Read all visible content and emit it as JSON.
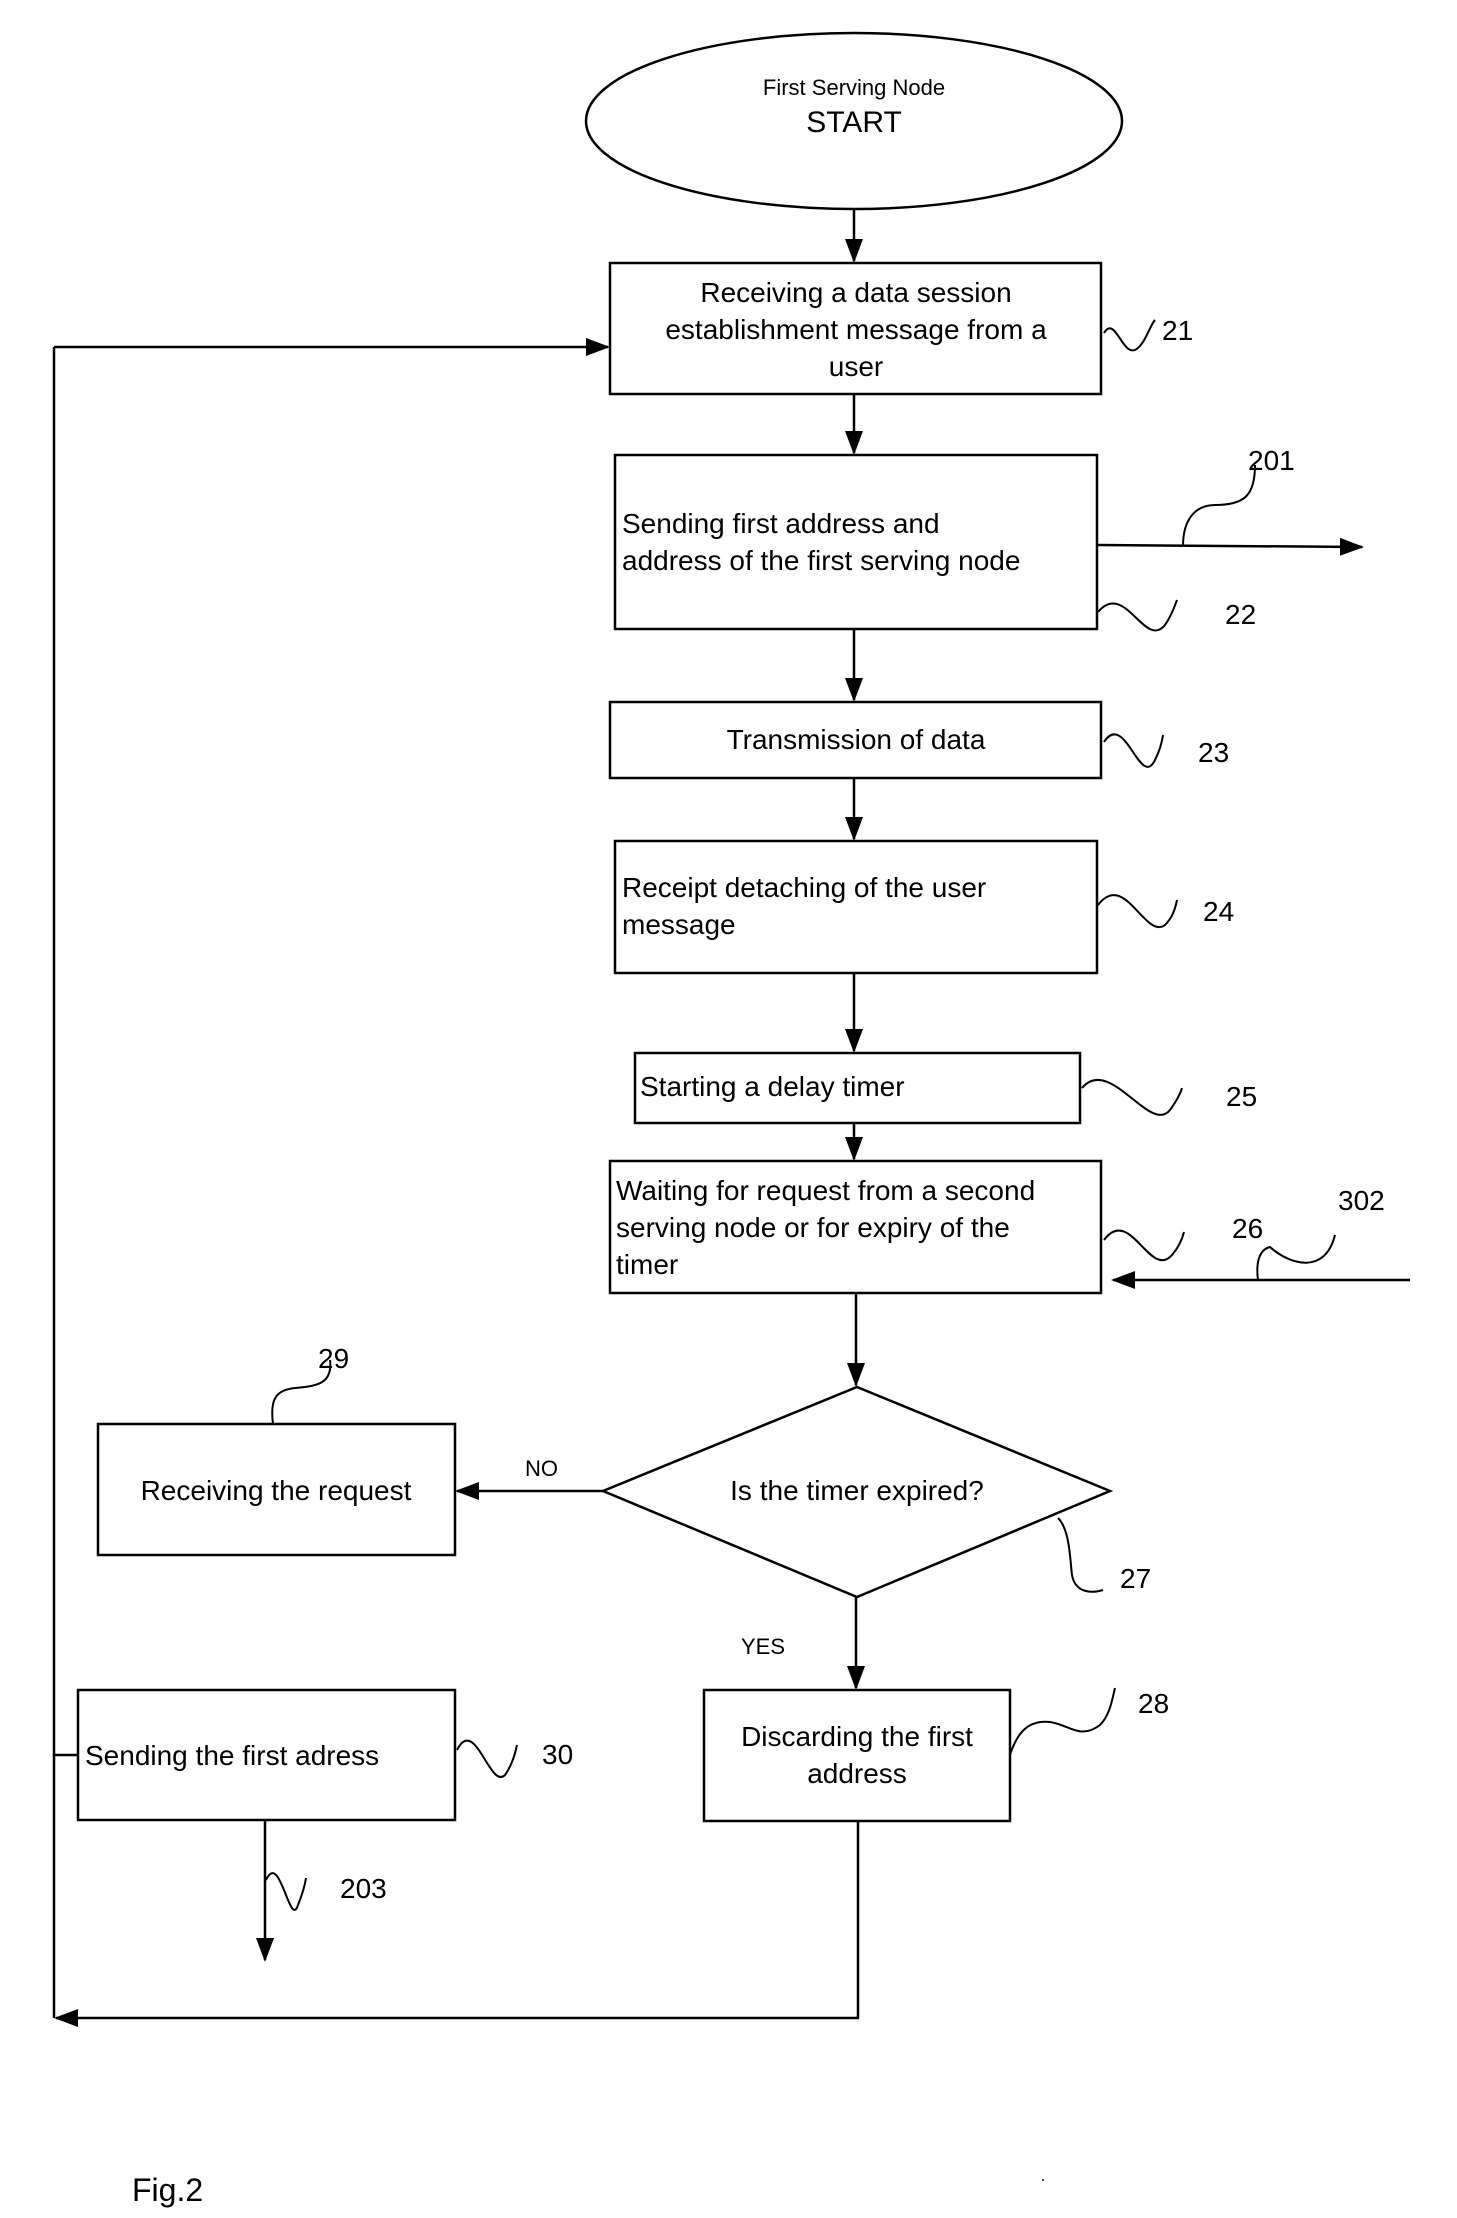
{
  "figure_label": "Fig.2",
  "start_node": {
    "title": "First Serving Node",
    "subtitle": "START"
  },
  "steps": [
    {
      "ref": "21",
      "lines": [
        "Receiving a data session",
        "establishment message from a",
        "user"
      ]
    },
    {
      "ref": "22",
      "lines": [
        "Sending first address and",
        "address of the first serving node"
      ]
    },
    {
      "ref": "23",
      "lines": [
        "Transmission of data"
      ]
    },
    {
      "ref": "24",
      "lines": [
        "Receipt  detaching of the user",
        "message"
      ]
    },
    {
      "ref": "25",
      "lines": [
        "Starting a delay timer"
      ]
    },
    {
      "ref": "26",
      "lines": [
        "Waiting for request from a second",
        "serving node or for expiry of the",
        "timer"
      ]
    },
    {
      "ref": "27",
      "lines": [
        "Is the timer expired?"
      ]
    },
    {
      "ref": "28",
      "lines": [
        "Discarding the first",
        "address"
      ]
    },
    {
      "ref": "29",
      "lines": [
        "Receiving the request"
      ]
    },
    {
      "ref": "30",
      "lines": [
        "Sending the first adress"
      ]
    }
  ],
  "branches": {
    "no": "NO",
    "yes": "YES"
  },
  "signals": {
    "out_201": "201",
    "in_302": "302",
    "out_203": "203"
  },
  "colors": {
    "stroke": "#000000",
    "background": "#ffffff"
  }
}
